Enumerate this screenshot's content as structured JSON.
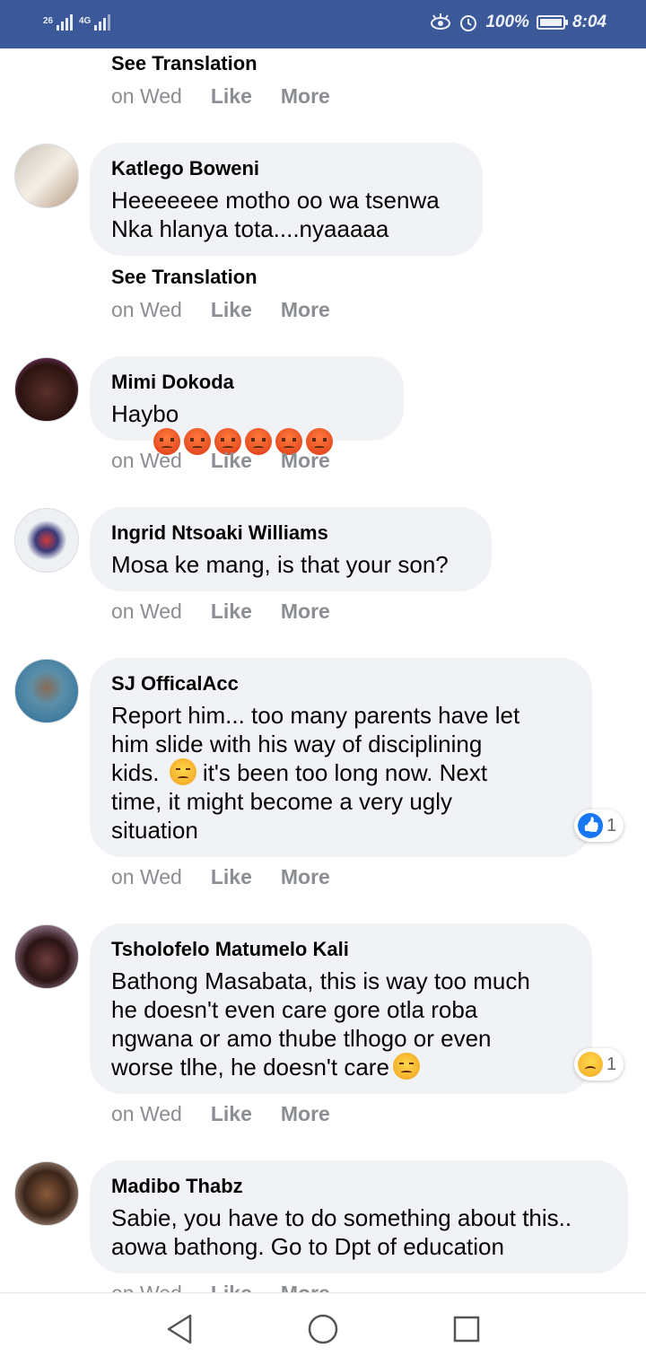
{
  "status_bar": {
    "signal1_label": "26",
    "signal2_label": "4G",
    "battery_percent": "100%",
    "time": "8:04",
    "battery_level": 1.0
  },
  "top_partial": {
    "see_translation": "See Translation",
    "time": "on Wed",
    "like": "Like",
    "more": "More"
  },
  "comments": [
    {
      "author": "Katlego Boweni",
      "text": "Heeeeeee motho oo wa tsenwa\nNka hlanya tota....nyaaaaa",
      "see_translation": "See Translation",
      "time": "on Wed",
      "like": "Like",
      "more": "More"
    },
    {
      "author": "Mimi Dokoda",
      "text": "Haybo",
      "emoji": "angry-face-icon",
      "emoji_count": 6,
      "time": "on Wed",
      "like": "Like",
      "more": "More"
    },
    {
      "author": "Ingrid Ntsoaki Williams",
      "text": "Mosa ke mang, is that your son?",
      "time": "on Wed",
      "like": "Like",
      "more": "More"
    },
    {
      "author": "SJ OfficalAcc",
      "text_before_emoji": "Report him... too many parents have let\nhim slide with his way of disciplining\nkids. ",
      "text_after_emoji": " it's been too long now. Next\ntime, it might become a very ugly\nsituation",
      "emoji": "pensive-face-icon",
      "reaction": {
        "type": "like-reaction-icon",
        "count": "1"
      },
      "time": "on Wed",
      "like": "Like",
      "more": "More"
    },
    {
      "author": "Tsholofelo Matumelo Kali",
      "text": "Bathong Masabata, this is way too much\nhe doesn't even care gore otla roba\nngwana or amo thube tlhogo or even\nworse tlhe, he doesn't care",
      "emoji": "disappointed-face-icon",
      "reaction": {
        "type": "sad-reaction-icon",
        "count": "1"
      },
      "time": "on Wed",
      "like": "Like",
      "more": "More"
    },
    {
      "author": "Madibo Thabz",
      "text": "Sabie, you have to do something about this..\naowa bathong. Go to Dpt of education",
      "time": "on Wed",
      "like": "Like",
      "more": "More"
    }
  ],
  "nav": {
    "back": "back-triangle-icon",
    "home": "home-circle-icon",
    "recents": "recents-square-icon"
  },
  "colors": {
    "status_bar": "#3b5998",
    "bubble": "#f0f2f5",
    "meta": "#8a8d91",
    "like_blue": "#1877f2"
  }
}
